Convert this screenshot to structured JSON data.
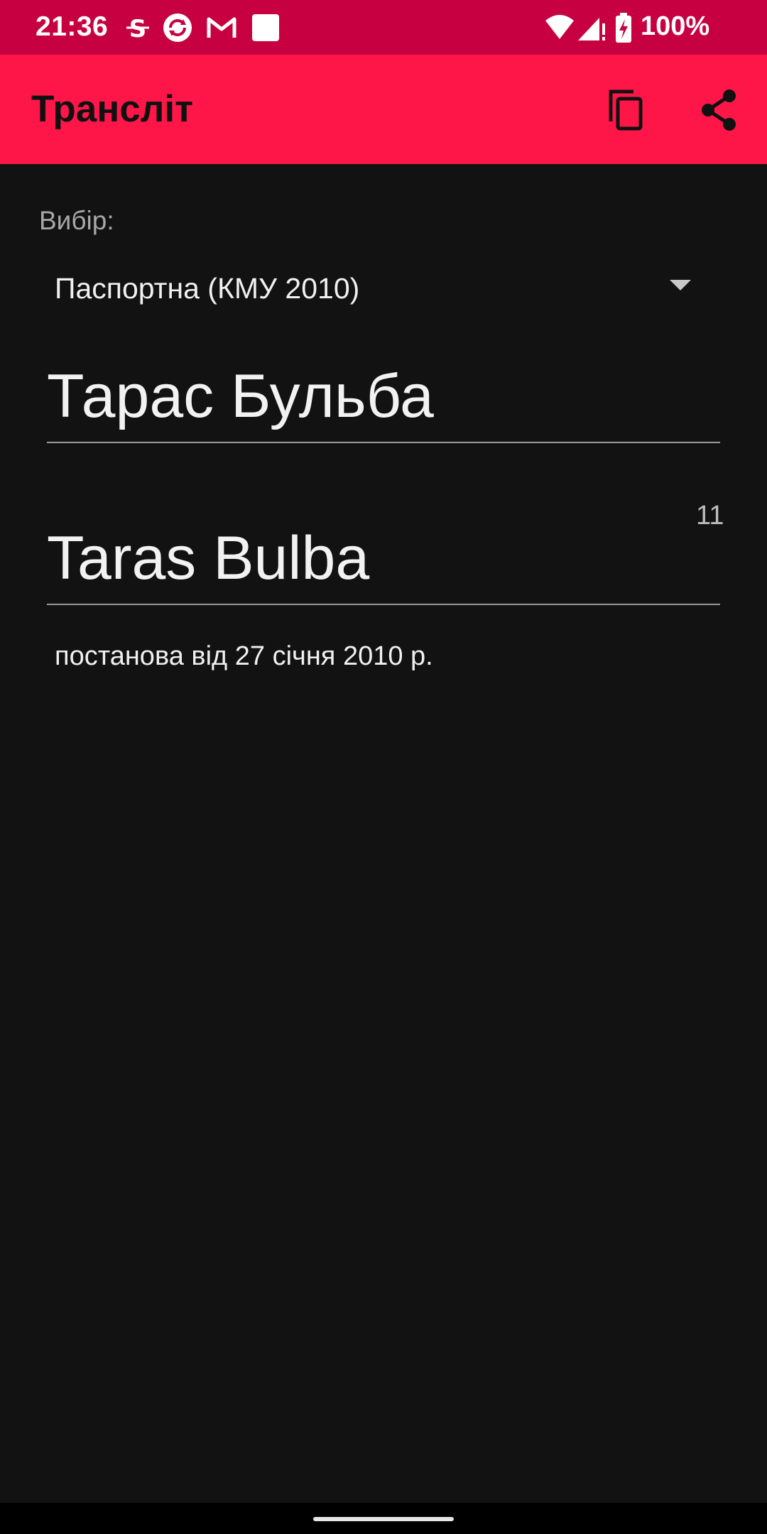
{
  "status_bar": {
    "time": "21:36",
    "battery": "100%",
    "icons": [
      "notification-s-icon",
      "sync-icon",
      "gmail-icon",
      "square-app-icon",
      "wifi-icon",
      "signal-icon",
      "battery-charging-icon"
    ],
    "background_color": "#c70042"
  },
  "app_bar": {
    "title": "Трансліт",
    "actions": [
      "copy-icon",
      "share-icon"
    ],
    "background_color": "#ff1648"
  },
  "main": {
    "selector_label": "Вибір:",
    "selector_value": "Паспортна (КМУ 2010)",
    "input_text": "Тарас Бульба",
    "output_char_count": "11",
    "output_text": "Taras Bulba",
    "note": "постанова від 27 січня 2010 р."
  },
  "theme": {
    "background": "#121212"
  }
}
